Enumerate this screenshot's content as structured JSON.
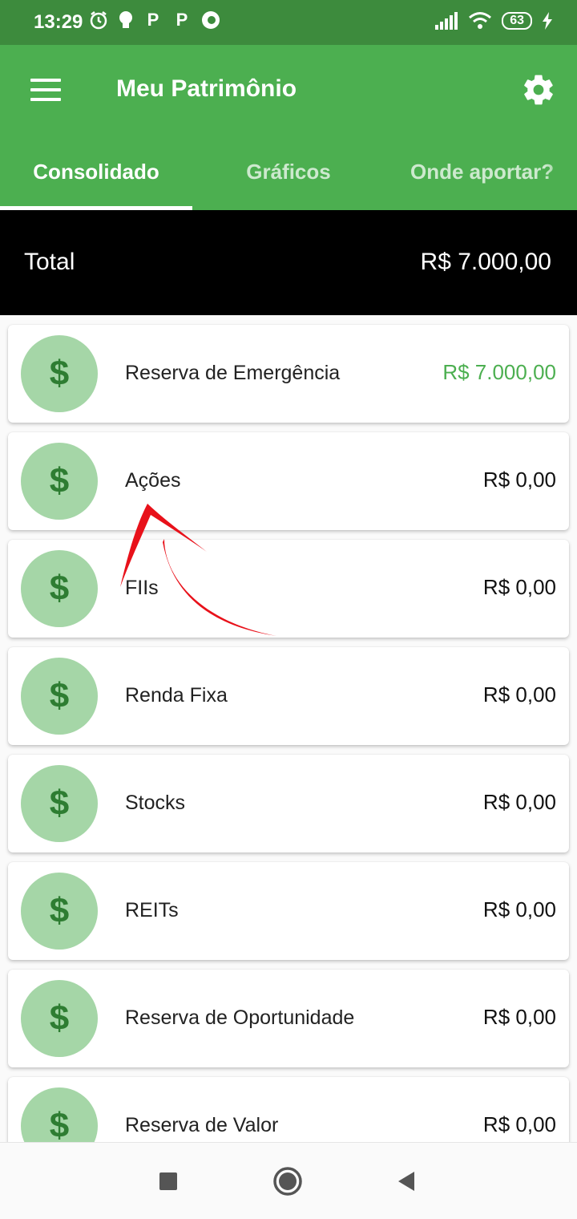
{
  "status_bar": {
    "time": "13:29",
    "left_icons": [
      "alarm-icon",
      "lightbulb-icon",
      "P",
      "P",
      "firefox-icon"
    ],
    "battery": "63"
  },
  "app_bar": {
    "title": "Meu Patrimônio",
    "tabs": [
      {
        "label": "Consolidado",
        "active": true
      },
      {
        "label": "Gráficos",
        "active": false
      },
      {
        "label": "Onde aportar?",
        "active": false
      }
    ]
  },
  "total": {
    "label": "Total",
    "value": "R$ 7.000,00"
  },
  "items": [
    {
      "icon": "$",
      "label": "Reserva de Emergência",
      "value": "R$ 7.000,00",
      "positive": true
    },
    {
      "icon": "$",
      "label": "Ações",
      "value": "R$ 0,00",
      "positive": false
    },
    {
      "icon": "$",
      "label": "FIIs",
      "value": "R$ 0,00",
      "positive": false
    },
    {
      "icon": "$",
      "label": "Renda Fixa",
      "value": "R$ 0,00",
      "positive": false
    },
    {
      "icon": "$",
      "label": "Stocks",
      "value": "R$ 0,00",
      "positive": false
    },
    {
      "icon": "$",
      "label": "REITs",
      "value": "R$ 0,00",
      "positive": false
    },
    {
      "icon": "$",
      "label": "Reserva de Oportunidade",
      "value": "R$ 0,00",
      "positive": false
    },
    {
      "icon": "$",
      "label": "Reserva de Valor",
      "value": "R$ 0,00",
      "positive": false
    }
  ],
  "colors": {
    "primary": "#4caf50",
    "status_bar": "#3d8b3d",
    "avatar_bg": "#a5d6a7",
    "avatar_fg": "#2e7d32",
    "annotation_arrow": "#e8111a"
  }
}
